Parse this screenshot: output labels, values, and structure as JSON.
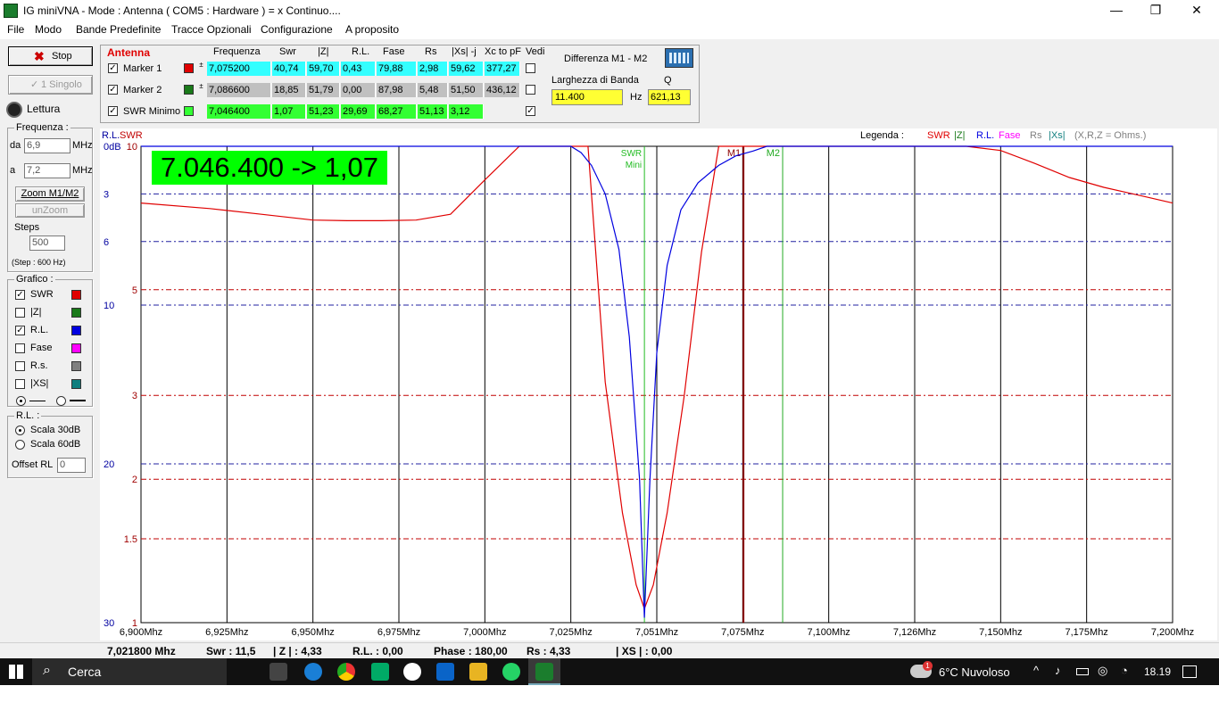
{
  "window": {
    "title": "IG miniVNA - Mode : Antenna ( COM5 :  Hardware ) = x Continuo....",
    "min": "—",
    "max": "❐",
    "close": "✕"
  },
  "menu": [
    "File",
    "Modo",
    "Bande Predefinite",
    "Tracce Opzionali",
    "Configurazione",
    "A proposito"
  ],
  "left": {
    "stop_label": "Stop",
    "single_label": "1 Singolo",
    "lettura_label": "Lettura",
    "freq_group": "Frequenza :",
    "da_label": "da",
    "da_value": "6,9",
    "a_label": "a",
    "a_value": "7,2",
    "mhz": "MHz",
    "zoom_label": "Zoom M1/M2",
    "unzoom_label": "unZoom",
    "steps_label": "Steps",
    "steps_value": "500",
    "step_info": "(Step : 600 Hz)",
    "grafico_group": "Grafico :",
    "traces": [
      {
        "label": "SWR",
        "checked": true,
        "color": "#e00000"
      },
      {
        "label": "|Z|",
        "checked": false,
        "color": "#1a7a1a"
      },
      {
        "label": "R.L.",
        "checked": true,
        "color": "#0000e0"
      },
      {
        "label": "Fase",
        "checked": false,
        "color": "#ff00ff"
      },
      {
        "label": "R.s.",
        "checked": false,
        "color": "#808080"
      },
      {
        "label": "|XS|",
        "checked": false,
        "color": "#107f7f"
      }
    ],
    "rl_group": "R.L. :",
    "scala30": "Scala 30dB",
    "scala60": "Scala 60dB",
    "offset_label": "Offset RL",
    "offset_value": "0"
  },
  "markers": {
    "title": "Antenna",
    "headers": [
      "Frequenza",
      "Swr",
      "|Z|",
      "R.L.",
      "Fase",
      "Rs",
      "|Xs| -j",
      "Xc to pF",
      "Vedi"
    ],
    "rows": [
      {
        "name": "Marker 1",
        "color": "#e00000",
        "bg": "#33ffff",
        "values": [
          "7,075200",
          "40,74",
          "59,70",
          "0,43",
          "79,88",
          "2,98",
          "59,62",
          "377,27"
        ],
        "vedi": false
      },
      {
        "name": "Marker 2",
        "color": "#1a7a1a",
        "bg": "#c0c0c0",
        "values": [
          "7,086600",
          "18,85",
          "51,79",
          "0,00",
          "87,98",
          "5,48",
          "51,50",
          "436,12"
        ],
        "vedi": false
      },
      {
        "name": "SWR Minimo",
        "color": "#33ff33",
        "bg": "#33ff33",
        "values": [
          "7,046400",
          "1,07",
          "51,23",
          "29,69",
          "68,27",
          "51,13",
          "3,12",
          ""
        ],
        "vedi": true
      }
    ],
    "diff_label": "Differenza M1 - M2",
    "bw_label": "Larghezza di Banda",
    "q_label": "Q",
    "bw_value": "11.400",
    "hz": "Hz",
    "q_value": "621,13"
  },
  "chart_data": {
    "type": "line",
    "big_readout": "7.046.400 -> 1,07",
    "left_axis_title": "R.L.",
    "right_axis_title": "SWR",
    "legend_label": "Legenda :",
    "legend_items": [
      {
        "text": "SWR",
        "color": "#e00000"
      },
      {
        "text": "|Z|",
        "color": "#1a7a1a"
      },
      {
        "text": "R.L.",
        "color": "#0000e0"
      },
      {
        "text": "Fase",
        "color": "#ff00ff"
      },
      {
        "text": "Rs",
        "color": "#808080"
      },
      {
        "text": "|Xs|",
        "color": "#107f7f"
      },
      {
        "text": "(X,R,Z = Ohms.)",
        "color": "#808080"
      }
    ],
    "x_range_mhz": [
      6.9,
      7.2
    ],
    "x_ticks": [
      "6,900Mhz",
      "6,925Mhz",
      "6,950Mhz",
      "6,975Mhz",
      "7,000Mhz",
      "7,025Mhz",
      "7,051Mhz",
      "7,075Mhz",
      "7,100Mhz",
      "7,126Mhz",
      "7,150Mhz",
      "7,175Mhz",
      "7,200Mhz"
    ],
    "rl_ticks": [
      {
        "v": 0,
        "t": "0dB"
      },
      {
        "v": 3,
        "t": "3"
      },
      {
        "v": 6,
        "t": "6"
      },
      {
        "v": 10,
        "t": "10"
      },
      {
        "v": 20,
        "t": "20"
      },
      {
        "v": 30,
        "t": "30"
      }
    ],
    "swr_ticks": [
      {
        "v": 10,
        "t": "10"
      },
      {
        "v": 5,
        "t": "5"
      },
      {
        "v": 3,
        "t": "3"
      },
      {
        "v": 2,
        "t": "2"
      },
      {
        "v": 1.5,
        "t": "1.5"
      },
      {
        "v": 1,
        "t": "1"
      }
    ],
    "markers": [
      {
        "label": "SWR",
        "label2": "Mini",
        "x": 7.0464,
        "color": "#22bb22"
      },
      {
        "label": "M1",
        "x": 7.0752,
        "color": "#8b0000"
      },
      {
        "label": "M2",
        "x": 7.0866,
        "color": "#22aa22"
      }
    ],
    "series": [
      {
        "name": "SWR",
        "color": "#e00000",
        "x": [
          6.9,
          6.92,
          6.935,
          6.95,
          6.96,
          6.97,
          6.98,
          6.99,
          7.0,
          7.01,
          7.015,
          7.02,
          7.025,
          7.03,
          7.035,
          7.04,
          7.044,
          7.0464,
          7.049,
          7.053,
          7.058,
          7.063,
          7.068,
          7.073,
          7.078,
          7.085,
          7.1,
          7.11,
          7.12,
          7.13,
          7.14,
          7.15,
          7.16,
          7.17,
          7.18,
          7.19,
          7.2
        ],
        "y": [
          7.6,
          7.4,
          7.2,
          7.0,
          6.98,
          6.98,
          7.0,
          7.2,
          8.5,
          11,
          14,
          22,
          45,
          10,
          3.2,
          1.7,
          1.2,
          1.07,
          1.2,
          1.7,
          3.0,
          6.0,
          14,
          45,
          99,
          99,
          90,
          21,
          15,
          12.5,
          11,
          9.8,
          9.2,
          8.6,
          8.2,
          7.9,
          7.6
        ]
      },
      {
        "name": "R.L.",
        "color": "#0000e0",
        "x": [
          6.9,
          7.0,
          7.025,
          7.028,
          7.031,
          7.035,
          7.039,
          7.042,
          7.045,
          7.0464,
          7.048,
          7.05,
          7.053,
          7.057,
          7.062,
          7.068,
          7.073,
          7.078,
          7.082,
          7.1,
          7.2
        ],
        "y": [
          0,
          0,
          0,
          0.4,
          1.2,
          3.0,
          6.5,
          12,
          21,
          29.69,
          21,
          13,
          7.5,
          4.0,
          2.3,
          1.2,
          0.6,
          0.3,
          0,
          0,
          0
        ]
      }
    ]
  },
  "status": {
    "freq": "7,021800 Mhz",
    "swr": "Swr : 11,5",
    "z": "| Z | : 4,33",
    "rl": "R.L. : 0,00",
    "phase": "Phase : 180,00",
    "rs": "Rs : 4,33",
    "xs": "| XS | : 0,00"
  },
  "taskbar": {
    "search": "Cerca",
    "weather": "6°C  Nuvoloso",
    "time": "18.19",
    "notif_count": "1"
  }
}
